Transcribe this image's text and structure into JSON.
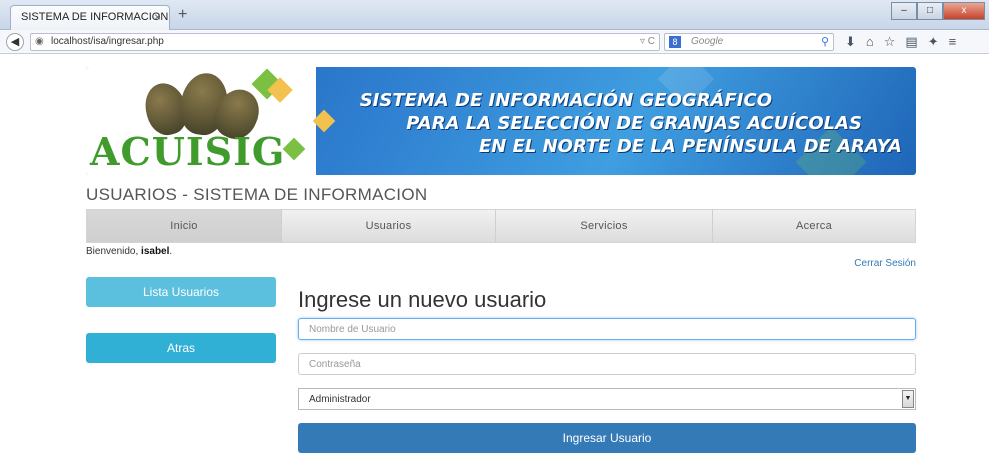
{
  "browser": {
    "tab_title": "SISTEMA DE INFORMACION G...",
    "tab_close": "×",
    "new_tab": "+",
    "url": "localhost/isa/ingresar.php",
    "search_engine_label": "8",
    "search_placeholder": "Google",
    "window_buttons": [
      "–",
      "□",
      "x"
    ]
  },
  "banner": {
    "logo_text": "ACUISIG",
    "title_lines": [
      "SISTEMA DE INFORMACIÓN GEOGRÁFICO",
      "PARA LA SELECCIÓN DE GRANJAS ACUÍCOLAS",
      "EN EL NORTE DE LA PENÍNSULA DE ARAYA"
    ]
  },
  "site_title": "USUARIOS - SISTEMA DE INFORMACION",
  "menu": [
    {
      "label": "Inicio",
      "active": true
    },
    {
      "label": "Usuarios",
      "active": false
    },
    {
      "label": "Servicios",
      "active": false
    },
    {
      "label": "Acerca",
      "active": false
    }
  ],
  "welcome": {
    "prefix": "Bienvenido, ",
    "user": "isabel",
    "suffix": "."
  },
  "logout_label": "Cerrar Sesión",
  "sidebar": {
    "list_users": "Lista Usuarios",
    "back": "Atras"
  },
  "form": {
    "title": "Ingrese un nuevo usuario",
    "username_placeholder": "Nombre de Usuario",
    "password_placeholder": "Contraseña",
    "role_selected": "Administrador",
    "submit_label": "Ingresar Usuario"
  },
  "colors": {
    "primary": "#337ab7",
    "info": "#5bc0de",
    "info_dark": "#31b0d5",
    "logo_green": "#3f9b2c",
    "banner_blue": "#2f7fd0"
  }
}
